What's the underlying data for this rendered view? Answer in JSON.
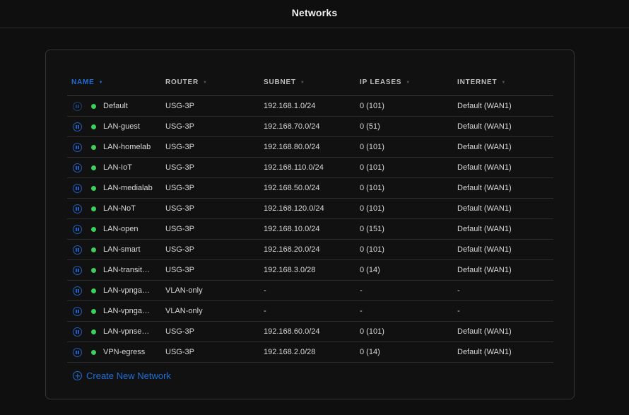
{
  "header": {
    "title": "Networks"
  },
  "colors": {
    "accent": "#1f6fd6",
    "status_ok": "#3ecf5a",
    "background": "#0f0f10"
  },
  "table": {
    "columns": [
      {
        "label": "NAME",
        "sorted": true
      },
      {
        "label": "ROUTER",
        "sorted": false
      },
      {
        "label": "SUBNET",
        "sorted": false
      },
      {
        "label": "IP LEASES",
        "sorted": false
      },
      {
        "label": "INTERNET",
        "sorted": false
      }
    ],
    "rows": [
      {
        "name": "Default",
        "router": "USG-3P",
        "subnet": "192.168.1.0/24",
        "leases": "0 (101)",
        "internet": "Default (WAN1)",
        "icon": "pause-icon",
        "status": "online"
      },
      {
        "name": "LAN-guest",
        "router": "USG-3P",
        "subnet": "192.168.70.0/24",
        "leases": "0 (51)",
        "internet": "Default (WAN1)",
        "icon": "pause-icon",
        "status": "online"
      },
      {
        "name": "LAN-homelab",
        "router": "USG-3P",
        "subnet": "192.168.80.0/24",
        "leases": "0 (101)",
        "internet": "Default (WAN1)",
        "icon": "pause-icon",
        "status": "online"
      },
      {
        "name": "LAN-IoT",
        "router": "USG-3P",
        "subnet": "192.168.110.0/24",
        "leases": "0 (101)",
        "internet": "Default (WAN1)",
        "icon": "pause-icon",
        "status": "online"
      },
      {
        "name": "LAN-medialab",
        "router": "USG-3P",
        "subnet": "192.168.50.0/24",
        "leases": "0 (101)",
        "internet": "Default (WAN1)",
        "icon": "pause-icon",
        "status": "online"
      },
      {
        "name": "LAN-NoT",
        "router": "USG-3P",
        "subnet": "192.168.120.0/24",
        "leases": "0 (101)",
        "internet": "Default (WAN1)",
        "icon": "pause-icon",
        "status": "online"
      },
      {
        "name": "LAN-open",
        "router": "USG-3P",
        "subnet": "192.168.10.0/24",
        "leases": "0 (151)",
        "internet": "Default (WAN1)",
        "icon": "pause-icon",
        "status": "online"
      },
      {
        "name": "LAN-smart",
        "router": "USG-3P",
        "subnet": "192.168.20.0/24",
        "leases": "0 (101)",
        "internet": "Default (WAN1)",
        "icon": "pause-icon",
        "status": "online"
      },
      {
        "name": "LAN-transit…",
        "router": "USG-3P",
        "subnet": "192.168.3.0/28",
        "leases": "0 (14)",
        "internet": "Default (WAN1)",
        "icon": "pause-icon",
        "status": "online"
      },
      {
        "name": "LAN-vpnga…",
        "router": "VLAN-only",
        "subnet": "-",
        "leases": "-",
        "internet": "-",
        "icon": "pause-icon",
        "status": "online"
      },
      {
        "name": "LAN-vpnga…",
        "router": "VLAN-only",
        "subnet": "-",
        "leases": "-",
        "internet": "-",
        "icon": "pause-icon",
        "status": "online"
      },
      {
        "name": "LAN-vpnse…",
        "router": "USG-3P",
        "subnet": "192.168.60.0/24",
        "leases": "0 (101)",
        "internet": "Default (WAN1)",
        "icon": "pause-icon",
        "status": "online"
      },
      {
        "name": "VPN-egress",
        "router": "USG-3P",
        "subnet": "192.168.2.0/28",
        "leases": "0 (14)",
        "internet": "Default (WAN1)",
        "icon": "pause-icon",
        "status": "online"
      }
    ]
  },
  "actions": {
    "create_label": "Create New Network",
    "create_icon": "plus-circle-icon"
  }
}
